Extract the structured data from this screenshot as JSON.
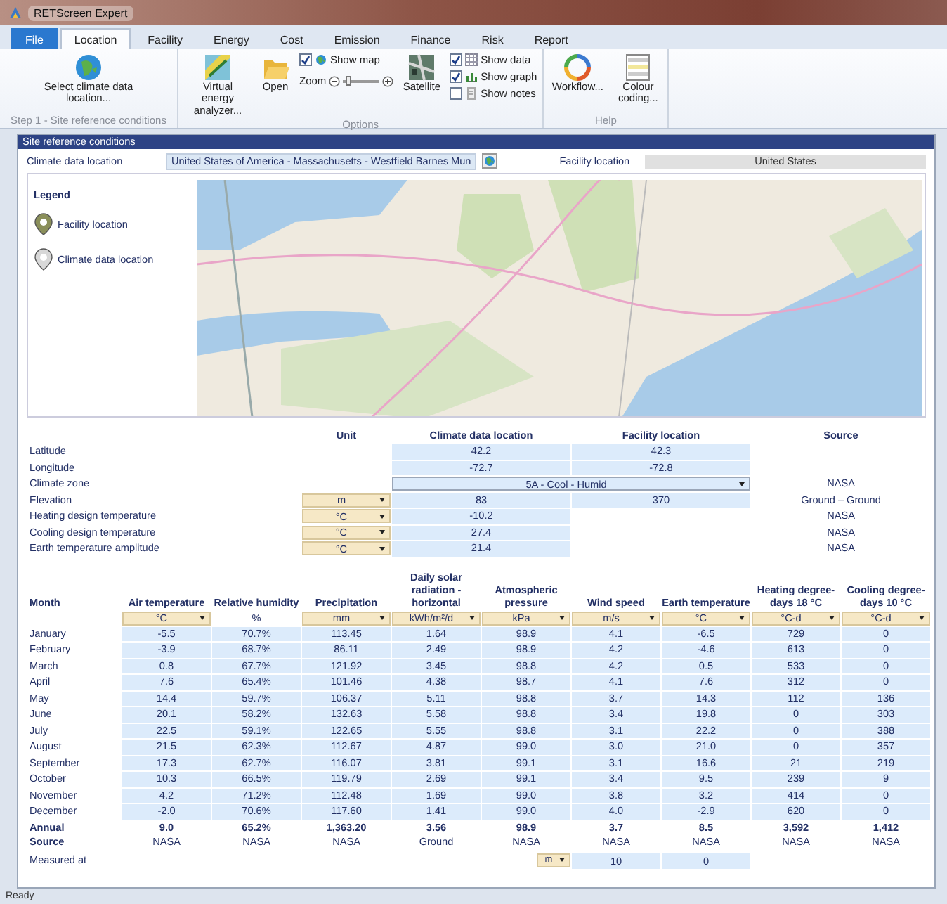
{
  "window": {
    "title": "RETScreen Expert"
  },
  "menu_tabs": [
    {
      "label": "File",
      "kind": "menu",
      "selected": false
    },
    {
      "label": "Location",
      "kind": "tab",
      "selected": true
    },
    {
      "label": "Facility",
      "kind": "tab",
      "selected": false
    },
    {
      "label": "Energy",
      "kind": "tab",
      "selected": false
    },
    {
      "label": "Cost",
      "kind": "tab",
      "selected": false
    },
    {
      "label": "Emission",
      "kind": "tab",
      "selected": false
    },
    {
      "label": "Finance",
      "kind": "tab",
      "selected": false
    },
    {
      "label": "Risk",
      "kind": "tab",
      "selected": false
    },
    {
      "label": "Report",
      "kind": "tab",
      "selected": false
    }
  ],
  "ribbon": {
    "step_group": {
      "select_button": "Select climate data location...",
      "caption": "Step 1 - Site reference conditions"
    },
    "options_group": {
      "virtual_button": "Virtual energy analyzer...",
      "open_button": "Open",
      "show_map": {
        "label": "Show map",
        "checked": true
      },
      "zoom": {
        "label": "Zoom",
        "level": 0.1
      },
      "satellite_button": "Satellite",
      "toggles": [
        {
          "label": "Show data",
          "checked": true
        },
        {
          "label": "Show graph",
          "checked": true
        },
        {
          "label": "Show notes",
          "checked": false
        }
      ],
      "caption": "Options"
    },
    "help_group": {
      "buttons": [
        "Workflow...",
        "Colour coding..."
      ],
      "caption": "Help"
    }
  },
  "site": {
    "title": "Site reference conditions",
    "climate_label": "Climate data location",
    "climate_value": "United States of America - Massachusetts - Westfield Barnes Mun",
    "facility_label": "Facility location",
    "facility_value": "United States",
    "legend": {
      "title": "Legend",
      "items": [
        "Facility location",
        "Climate data location"
      ]
    }
  },
  "parameters": {
    "columns": [
      "Unit",
      "Climate data location",
      "Facility location",
      "Source"
    ],
    "rows": [
      {
        "label": "Latitude",
        "kind": "values",
        "climate": "42.2",
        "facility": "42.3"
      },
      {
        "label": "Longitude",
        "kind": "values",
        "climate": "-72.7",
        "facility": "-72.8"
      },
      {
        "label": "Climate zone",
        "kind": "dropdown",
        "value": "5A - Cool - Humid",
        "source": "NASA"
      },
      {
        "label": "Elevation",
        "kind": "values",
        "unit": "m",
        "climate": "83",
        "facility": "370",
        "source": "Ground – Ground"
      },
      {
        "label": "Heating design temperature",
        "kind": "values",
        "unit": "°C",
        "climate": "-10.2",
        "source": "NASA"
      },
      {
        "label": "Cooling design temperature",
        "kind": "values",
        "unit": "°C",
        "climate": "27.4",
        "source": "NASA"
      },
      {
        "label": "Earth temperature amplitude",
        "kind": "values",
        "unit": "°C",
        "climate": "21.4",
        "source": "NASA"
      }
    ]
  },
  "monthly": {
    "month_header": "Month",
    "columns": [
      {
        "header": "Air temperature",
        "unit": "°C",
        "kind": "dropdown"
      },
      {
        "header": "Relative humidity",
        "unit": "%",
        "kind": "fixed"
      },
      {
        "header": "Precipitation",
        "unit": "mm",
        "kind": "dropdown"
      },
      {
        "header": "Daily solar radiation - horizontal",
        "unit": "kWh/m²/d",
        "kind": "dropdown"
      },
      {
        "header": "Atmospheric pressure",
        "unit": "kPa",
        "kind": "dropdown"
      },
      {
        "header": "Wind speed",
        "unit": "m/s",
        "kind": "dropdown"
      },
      {
        "header": "Earth temperature",
        "unit": "°C",
        "kind": "dropdown"
      },
      {
        "header": "Heating degree-days 18 °C",
        "unit": "°C-d",
        "kind": "dropdown"
      },
      {
        "header": "Cooling degree-days 10 °C",
        "unit": "°C-d",
        "kind": "dropdown"
      }
    ],
    "rows": [
      {
        "month": "January",
        "values": [
          "-5.5",
          "70.7%",
          "113.45",
          "1.64",
          "98.9",
          "4.1",
          "-6.5",
          "729",
          "0"
        ]
      },
      {
        "month": "February",
        "values": [
          "-3.9",
          "68.7%",
          "86.11",
          "2.49",
          "98.9",
          "4.2",
          "-4.6",
          "613",
          "0"
        ]
      },
      {
        "month": "March",
        "values": [
          "0.8",
          "67.7%",
          "121.92",
          "3.45",
          "98.8",
          "4.2",
          "0.5",
          "533",
          "0"
        ]
      },
      {
        "month": "April",
        "values": [
          "7.6",
          "65.4%",
          "101.46",
          "4.38",
          "98.7",
          "4.1",
          "7.6",
          "312",
          "0"
        ]
      },
      {
        "month": "May",
        "values": [
          "14.4",
          "59.7%",
          "106.37",
          "5.11",
          "98.8",
          "3.7",
          "14.3",
          "112",
          "136"
        ]
      },
      {
        "month": "June",
        "values": [
          "20.1",
          "58.2%",
          "132.63",
          "5.58",
          "98.8",
          "3.4",
          "19.8",
          "0",
          "303"
        ]
      },
      {
        "month": "July",
        "values": [
          "22.5",
          "59.1%",
          "122.65",
          "5.55",
          "98.8",
          "3.1",
          "22.2",
          "0",
          "388"
        ]
      },
      {
        "month": "August",
        "values": [
          "21.5",
          "62.3%",
          "112.67",
          "4.87",
          "99.0",
          "3.0",
          "21.0",
          "0",
          "357"
        ]
      },
      {
        "month": "September",
        "values": [
          "17.3",
          "62.7%",
          "116.07",
          "3.81",
          "99.1",
          "3.1",
          "16.6",
          "21",
          "219"
        ]
      },
      {
        "month": "October",
        "values": [
          "10.3",
          "66.5%",
          "119.79",
          "2.69",
          "99.1",
          "3.4",
          "9.5",
          "239",
          "9"
        ]
      },
      {
        "month": "November",
        "values": [
          "4.2",
          "71.2%",
          "112.48",
          "1.69",
          "99.0",
          "3.8",
          "3.2",
          "414",
          "0"
        ]
      },
      {
        "month": "December",
        "values": [
          "-2.0",
          "70.6%",
          "117.60",
          "1.41",
          "99.0",
          "4.0",
          "-2.9",
          "620",
          "0"
        ]
      }
    ],
    "annual": {
      "label": "Annual",
      "values": [
        "9.0",
        "65.2%",
        "1,363.20",
        "3.56",
        "98.9",
        "3.7",
        "8.5",
        "3,592",
        "1,412"
      ]
    },
    "source": {
      "label": "Source",
      "values": [
        "NASA",
        "NASA",
        "NASA",
        "Ground",
        "NASA",
        "NASA",
        "NASA",
        "NASA",
        "NASA"
      ]
    },
    "measured_at": {
      "label": "Measured at",
      "unit": "m",
      "values": [
        "10",
        "0"
      ]
    }
  },
  "status_bar": {
    "text": "Ready"
  }
}
